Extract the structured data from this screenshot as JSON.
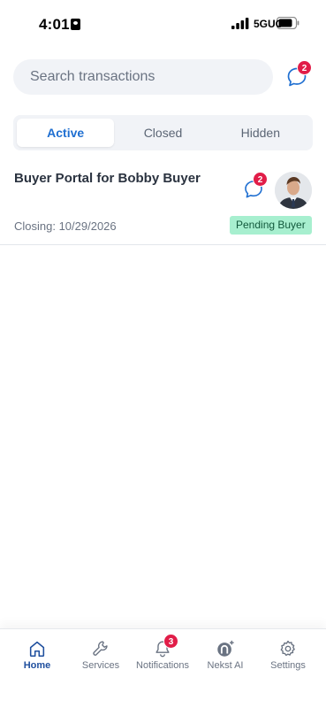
{
  "status_bar": {
    "time": "4:01",
    "network": "5GUC"
  },
  "search": {
    "placeholder": "Search transactions",
    "chat_badge_count": "2"
  },
  "tabs": [
    {
      "label": "Active",
      "selected": true
    },
    {
      "label": "Closed",
      "selected": false
    },
    {
      "label": "Hidden",
      "selected": false
    }
  ],
  "transactions": [
    {
      "title": "Buyer Portal for Bobby Buyer",
      "closing": "Closing: 10/29/2026",
      "chat_badge_count": "2",
      "status": "Pending Buyer"
    }
  ],
  "bottom_nav": {
    "items": [
      {
        "label": "Home",
        "icon": "home-icon",
        "active": true
      },
      {
        "label": "Services",
        "icon": "wrench-icon",
        "active": false
      },
      {
        "label": "Notifications",
        "icon": "bell-icon",
        "active": false
      },
      {
        "label": "Nekst AI",
        "icon": "nekst-ai-icon",
        "active": false
      },
      {
        "label": "Settings",
        "icon": "gear-icon",
        "active": false
      }
    ],
    "notifications_badge_count": "3"
  },
  "colors": {
    "accent": "#1f6fd1",
    "badge": "#e11d48",
    "status_bg": "#a7efcf",
    "status_text": "#11583b",
    "search_bg": "#f1f3f7"
  }
}
